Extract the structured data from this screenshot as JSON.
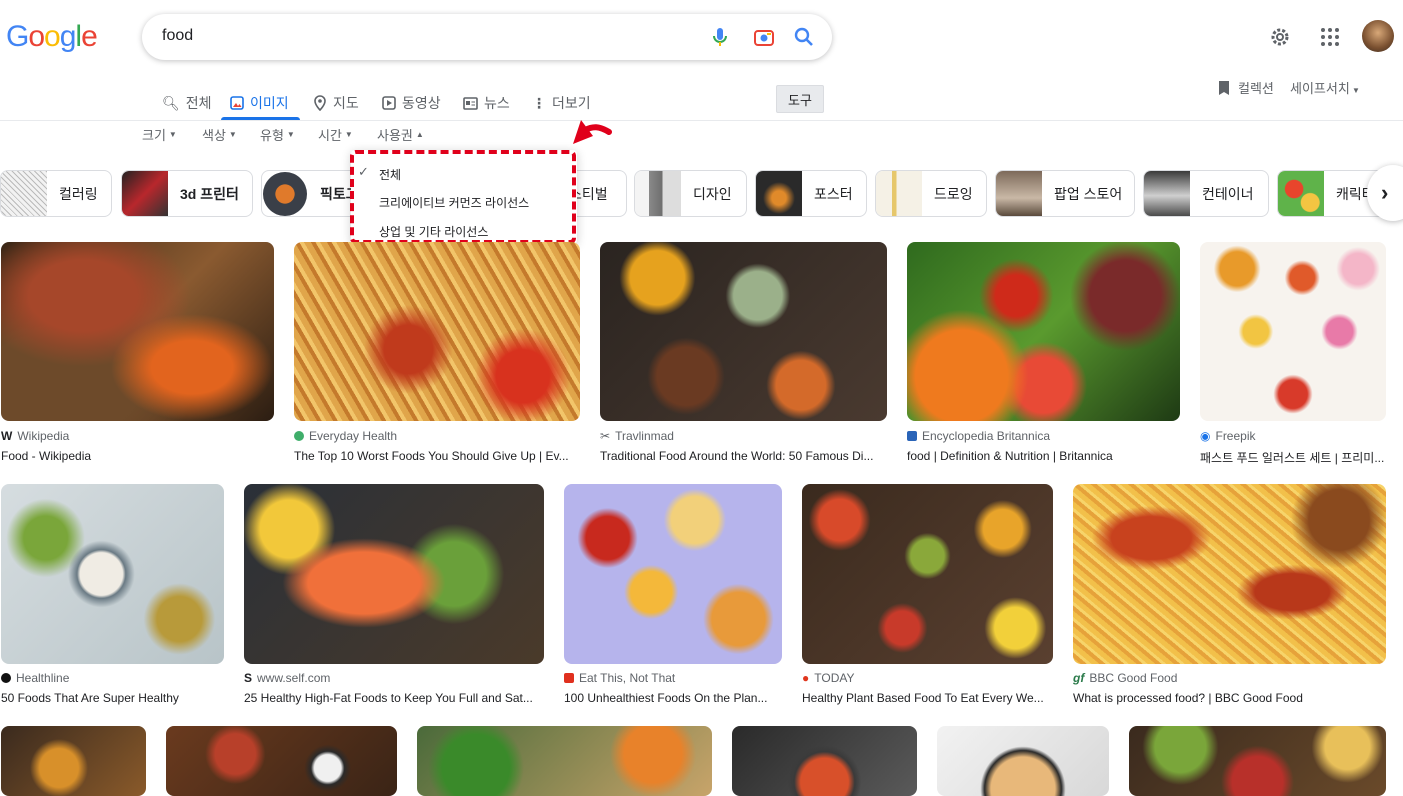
{
  "header": {
    "logo_letters": [
      "G",
      "o",
      "o",
      "g",
      "l",
      "e"
    ],
    "logo_colors": [
      "#4285f4",
      "#ea4335",
      "#fbbc05",
      "#4285f4",
      "#34a853",
      "#ea4335"
    ],
    "query": "food",
    "icons": [
      "mic-icon",
      "camera-icon",
      "search-icon",
      "settings-icon",
      "apps-icon",
      "avatar"
    ]
  },
  "tabs": [
    {
      "label": "전체",
      "icon": "search-icon"
    },
    {
      "label": "이미지",
      "icon": "image-icon",
      "active": true
    },
    {
      "label": "지도",
      "icon": "pin-icon"
    },
    {
      "label": "동영상",
      "icon": "play-icon"
    },
    {
      "label": "뉴스",
      "icon": "news-icon"
    },
    {
      "label": "더보기",
      "icon": "more-icon"
    }
  ],
  "tools_label": "도구",
  "collection_label": "컬렉션",
  "safesearch_label": "세이프서치",
  "filters": [
    "크기",
    "색상",
    "유형",
    "시간",
    "사용권"
  ],
  "license_menu": {
    "options": [
      "전체",
      "크리에이티브 커먼즈 라이선스",
      "상업 및 기타 라이선스"
    ],
    "selected": "전체"
  },
  "chips": [
    "컬러링",
    "3d 프린터",
    "픽토그",
    "스티벌",
    "디자인",
    "포스터",
    "드로잉",
    "팝업 스토어",
    "컨테이너",
    "캐릭터"
  ],
  "results": [
    {
      "source": "Wikipedia",
      "title": "Food - Wikipedia"
    },
    {
      "source": "Everyday Health",
      "title": "The Top 10 Worst Foods You Should Give Up | Ev..."
    },
    {
      "source": "Travlinmad",
      "title": "Traditional Food Around the World: 50 Famous Di..."
    },
    {
      "source": "Encyclopedia Britannica",
      "title": "food | Definition & Nutrition | Britannica"
    },
    {
      "source": "Freepik",
      "title": "패스트 푸드 일러스트 세트 | 프리미..."
    },
    {
      "source": "Healthline",
      "title": "50 Foods That Are Super Healthy"
    },
    {
      "source": "www.self.com",
      "title": "25 Healthy High-Fat Foods to Keep You Full and Sat..."
    },
    {
      "source": "Eat This, Not That",
      "title": "100 Unhealthiest Foods On the Plan..."
    },
    {
      "source": "TODAY",
      "title": "Healthy Plant Based Food To Eat Every We..."
    },
    {
      "source": "BBC Good Food",
      "title": "What is processed food? | BBC Good Food"
    }
  ]
}
